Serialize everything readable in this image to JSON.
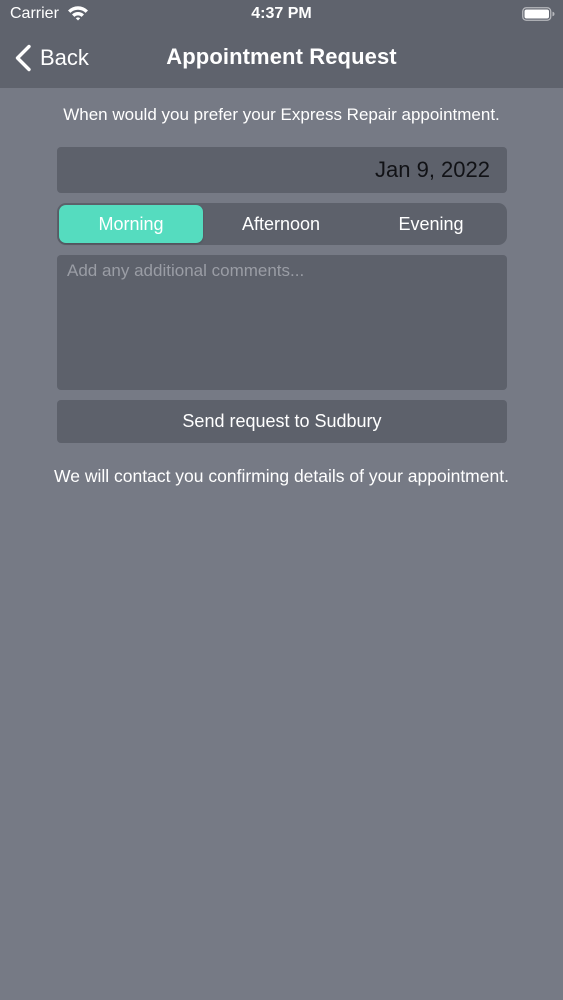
{
  "status_bar": {
    "carrier": "Carrier",
    "time": "4:37 PM",
    "icons": [
      "wifi-icon",
      "battery-icon"
    ]
  },
  "nav": {
    "back_label": "Back",
    "title": "Appointment Request",
    "back_icon": "chevron-left-icon"
  },
  "form": {
    "prompt": "When would you prefer your Express Repair appointment.",
    "date_value": "Jan 9, 2022",
    "time_of_day": {
      "options": [
        "Morning",
        "Afternoon",
        "Evening"
      ],
      "selected": "Morning"
    },
    "comments": {
      "value": "",
      "placeholder": "Add any additional comments..."
    },
    "send_label": "Send request to Sudbury",
    "footer_note": "We will contact you confirming details of your appointment."
  },
  "colors": {
    "background": "#767a85",
    "top_chrome": "#5f636d",
    "field_background": "#5d616b",
    "accent": "#55dcbf",
    "text": "#ffffff",
    "date_text": "#111216",
    "placeholder": "#9a9da5"
  }
}
